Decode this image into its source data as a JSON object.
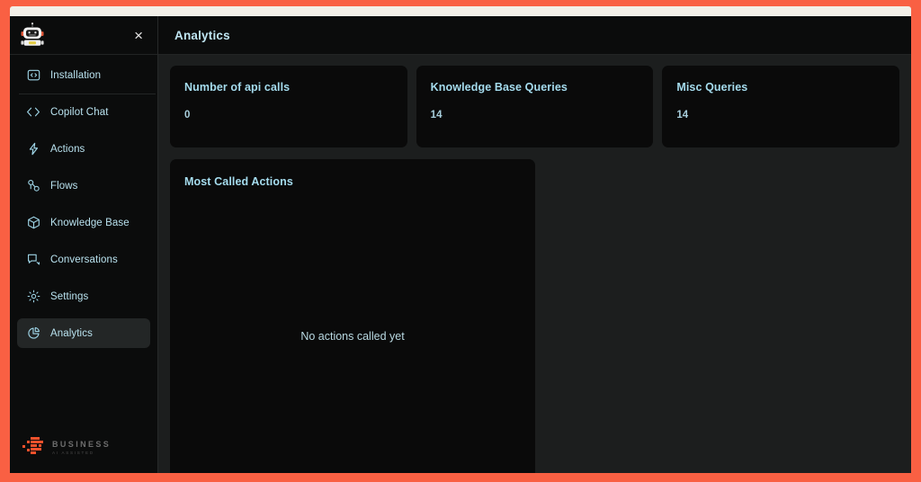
{
  "theme": {
    "frame_color": "#f96043",
    "top_strip_color": "#f2efe8",
    "window_bg": "#1c1e1e",
    "sidebar_bg": "#0b0c0c",
    "card_bg": "#0a0a0a",
    "accent_text": "#a5dcee",
    "brand_orange": "#f4512c"
  },
  "sidebar": {
    "avatar_icon": "robot-avatar-icon",
    "close_label": "×",
    "items": [
      {
        "label": "Installation",
        "icon": "code-box-icon",
        "active": false
      },
      {
        "label": "Copilot Chat",
        "icon": "code-brackets-icon",
        "active": false
      },
      {
        "label": "Actions",
        "icon": "lightning-bolt-icon",
        "active": false
      },
      {
        "label": "Flows",
        "icon": "flow-nodes-icon",
        "active": false
      },
      {
        "label": "Knowledge Base",
        "icon": "cube-box-icon",
        "active": false
      },
      {
        "label": "Conversations",
        "icon": "chat-bubbles-icon",
        "active": false
      },
      {
        "label": "Settings",
        "icon": "gear-icon",
        "active": false
      },
      {
        "label": "Analytics",
        "icon": "pie-chart-icon",
        "active": true
      }
    ],
    "brand": {
      "name": "BUSINESS",
      "tagline": "AI ASSISTED",
      "logo_icon": "business-blocks-logo-icon"
    }
  },
  "header": {
    "title": "Analytics"
  },
  "main": {
    "stats": [
      {
        "title": "Number of api calls",
        "value": "0"
      },
      {
        "title": "Knowledge Base Queries",
        "value": "14"
      },
      {
        "title": "Misc Queries",
        "value": "14"
      }
    ],
    "panel": {
      "title": "Most Called Actions",
      "empty_message": "No actions called yet"
    }
  }
}
